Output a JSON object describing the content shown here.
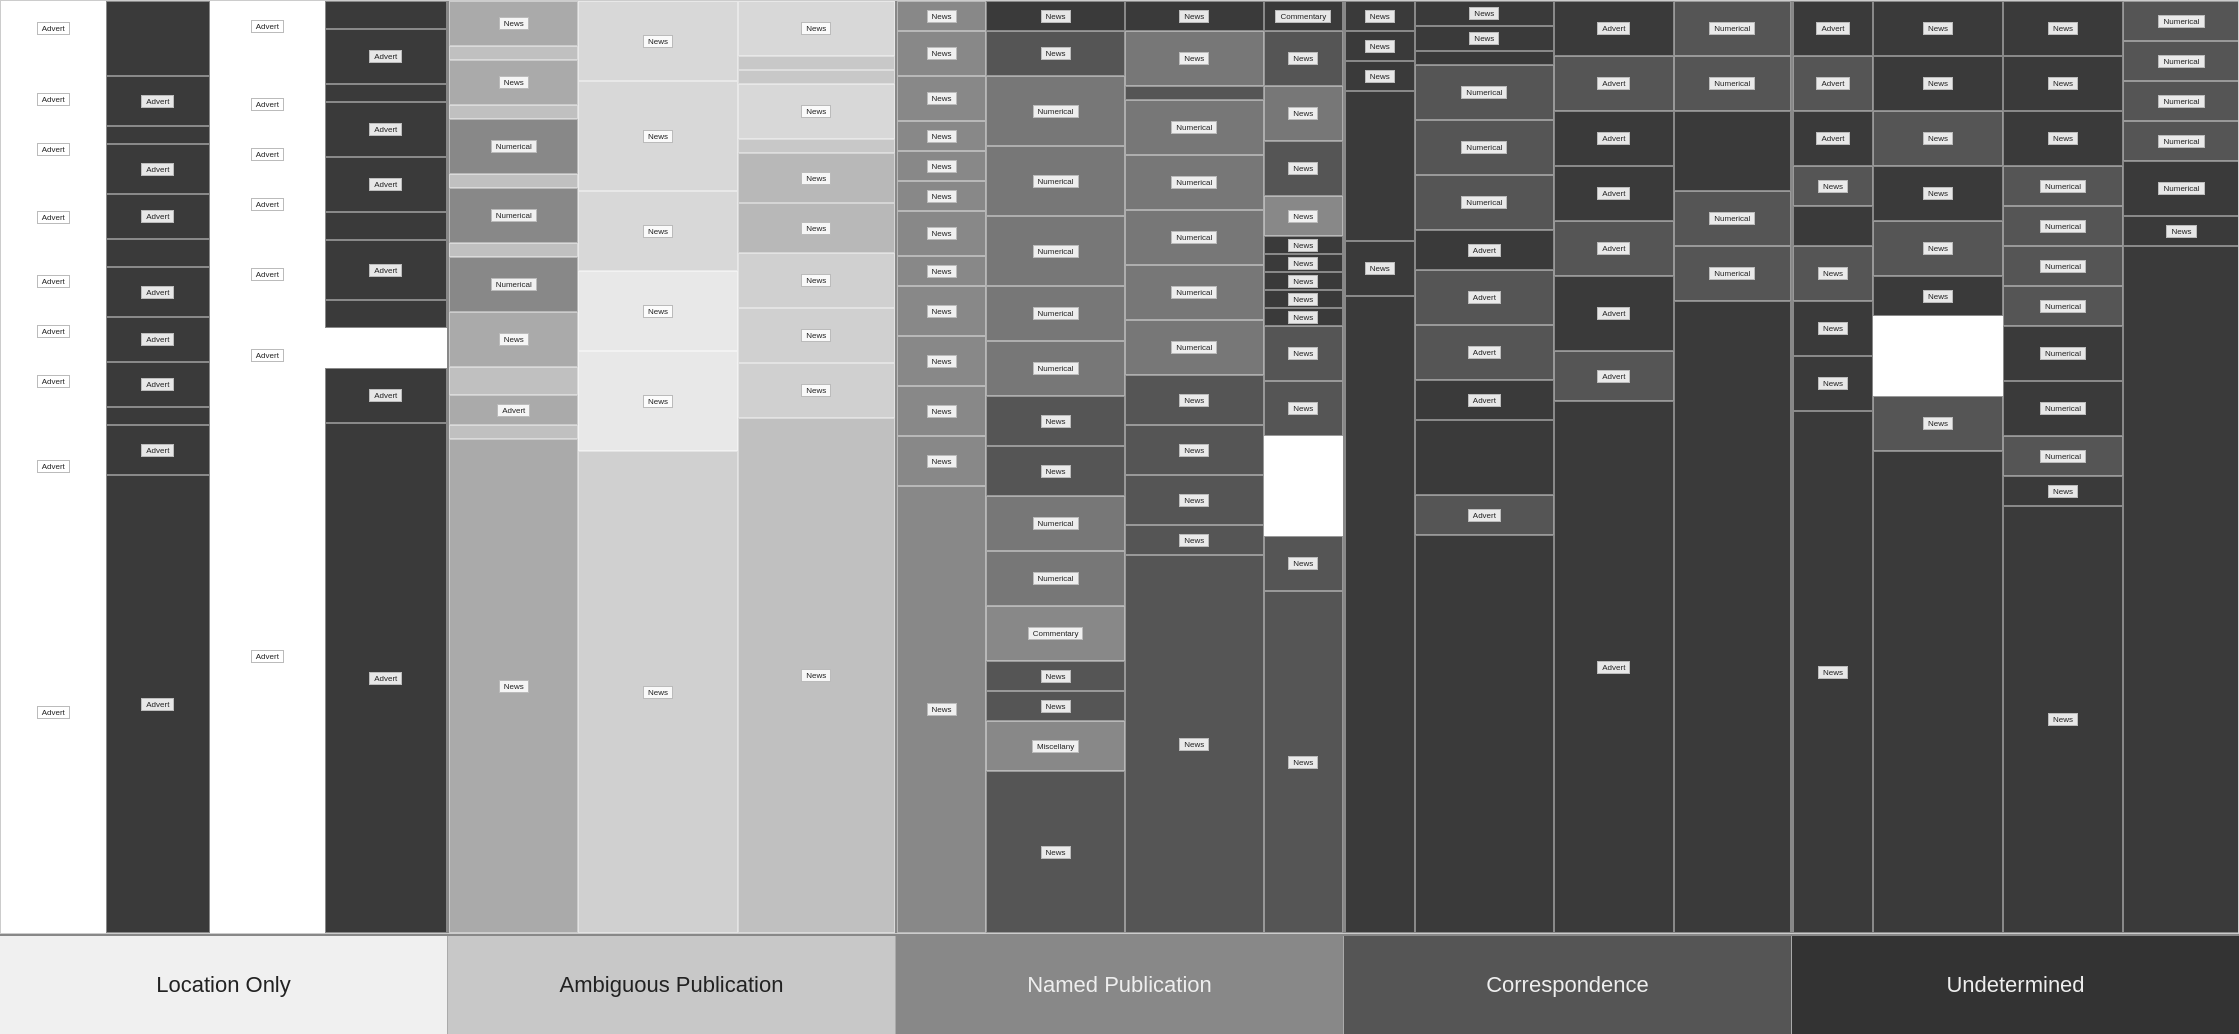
{
  "legend": {
    "items": [
      {
        "id": "location",
        "label": "Location Only",
        "color": "#e8e8e8",
        "text_color": "#222"
      },
      {
        "id": "ambiguous",
        "label": "Ambiguous Publication",
        "color": "#c0c0c0",
        "text_color": "#222"
      },
      {
        "id": "named",
        "label": "Named Publication",
        "color": "#888888",
        "text_color": "#eee"
      },
      {
        "id": "correspondence",
        "label": "Correspondence",
        "color": "#555555",
        "text_color": "#eee"
      },
      {
        "id": "undetermined",
        "label": "Undetermined",
        "color": "#333333",
        "text_color": "#eee"
      }
    ]
  },
  "sections": {
    "location": {
      "label": "Location Only",
      "columns": [
        {
          "color": "#ffffff",
          "cells": [
            {
              "label": "Advert",
              "h": 60
            },
            {
              "h": 20
            },
            {
              "label": "Advert",
              "h": 55
            },
            {
              "label": "Advert",
              "h": 55
            },
            {
              "h": 20
            },
            {
              "label": "Advert",
              "h": 50
            },
            {
              "h": 15
            },
            {
              "label": "Advert",
              "h": 50
            },
            {
              "label": "Advert",
              "h": 55
            },
            {
              "label": "Advert",
              "h": 55
            },
            {
              "h": 40
            },
            {
              "label": "Advert",
              "h": 55
            },
            {
              "label": "Advert",
              "h": 55
            }
          ]
        },
        {
          "color": "#3a3a3a",
          "cells": [
            {
              "h": 80
            },
            {
              "label": "Advert",
              "h": 55
            },
            {
              "h": 20
            },
            {
              "label": "Advert",
              "h": 50
            },
            {
              "label": "Advert",
              "h": 50
            },
            {
              "h": 30
            },
            {
              "label": "Advert",
              "h": 55
            },
            {
              "label": "Advert",
              "h": 50
            },
            {
              "label": "Advert",
              "h": 50
            },
            {
              "h": 20
            },
            {
              "label": "Advert",
              "h": 55
            },
            {
              "label": "Advert",
              "h": 50
            }
          ]
        },
        {
          "color": "#ffffff",
          "cells": [
            {
              "label": "Advert",
              "h": 70
            },
            {
              "h": 30
            },
            {
              "label": "Advert",
              "h": 55
            },
            {
              "label": "Advert",
              "h": 55
            },
            {
              "label": "Advert",
              "h": 55
            },
            {
              "h": 20
            },
            {
              "label": "Advert",
              "h": 60
            },
            {
              "h": 30
            },
            {
              "label": "Advert",
              "h": 55
            },
            {
              "label": "Advert",
              "h": 55
            }
          ]
        },
        {
          "color": "#3a3a3a",
          "cells": [
            {
              "h": 30
            },
            {
              "label": "Advert",
              "h": 60
            },
            {
              "h": 20
            },
            {
              "label": "Advert",
              "h": 60
            },
            {
              "label": "Advert",
              "h": 60
            },
            {
              "h": 30
            },
            {
              "label": "Advert",
              "h": 65
            },
            {
              "h": 30
            },
            {
              "label": "Advert",
              "h": 65
            },
            {
              "label": "Advert",
              "h": 60
            }
          ]
        }
      ]
    }
  }
}
